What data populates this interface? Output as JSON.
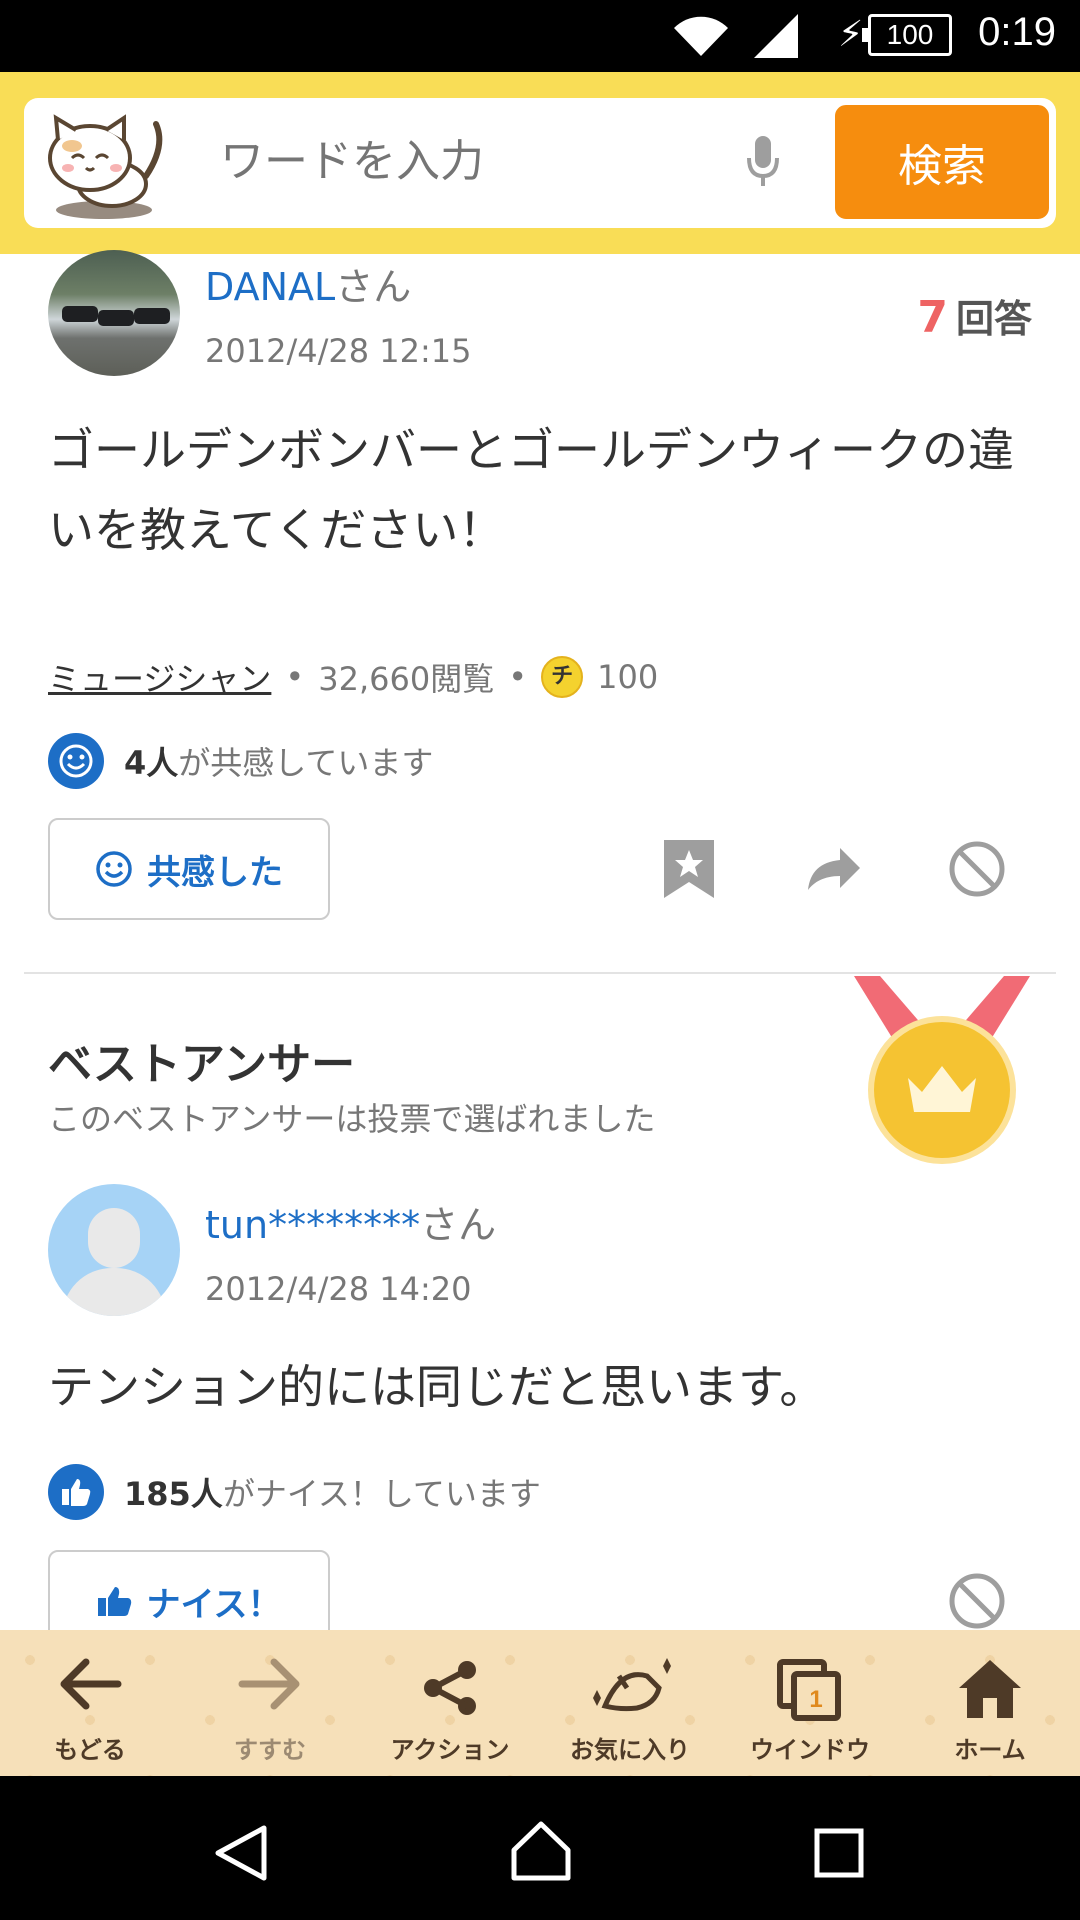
{
  "status_bar": {
    "time": "0:19",
    "battery": "100",
    "icons": [
      "wifi-icon",
      "signal-icon",
      "charging-icon",
      "battery-icon"
    ]
  },
  "search": {
    "placeholder": "ワードを入力",
    "button_label": "検索",
    "icons": [
      "cat-mascot-icon",
      "mic-icon"
    ]
  },
  "question": {
    "user": "DANAL",
    "user_suffix": "さん",
    "date": "2012/4/28 12:15",
    "answer_count": "7",
    "answer_label": "回答",
    "body": "ゴールデンボンバーとゴールデンウィークの違いを教えてください！",
    "category": "ミュージシャン",
    "views": "32,660閲覧",
    "coin_label": "チ",
    "coin_value": "100",
    "empathy_count": "4人",
    "empathy_text": "が共感しています",
    "empathy_button": "共感した",
    "tool_icons": [
      "bookmark-icon",
      "share-icon",
      "block-icon"
    ]
  },
  "best_answer": {
    "title": "ベストアンサー",
    "subtitle": "このベストアンサーは投票で選ばれました",
    "user": "tun********",
    "user_suffix": "さん",
    "date": "2012/4/28 14:20",
    "body": "テンション的には同じだと思います。",
    "nice_count": "185人",
    "nice_text": "がナイス！しています",
    "nice_button": "ナイス！",
    "accent_color": "#f5c332"
  },
  "toolbar": {
    "items": [
      {
        "label": "もどる",
        "icon": "back-arrow-icon"
      },
      {
        "label": "すすむ",
        "icon": "forward-arrow-icon"
      },
      {
        "label": "アクション",
        "icon": "share-icon"
      },
      {
        "label": "お気に入り",
        "icon": "favorite-icon"
      },
      {
        "label": "ウインドウ",
        "icon": "window-icon",
        "badge": "1"
      },
      {
        "label": "ホーム",
        "icon": "home-icon"
      }
    ]
  },
  "colors": {
    "accent": "#f68d0e",
    "link": "#1d6ec6",
    "header_band": "#f9dd56",
    "toolbar_bg": "#f6e0b9"
  }
}
